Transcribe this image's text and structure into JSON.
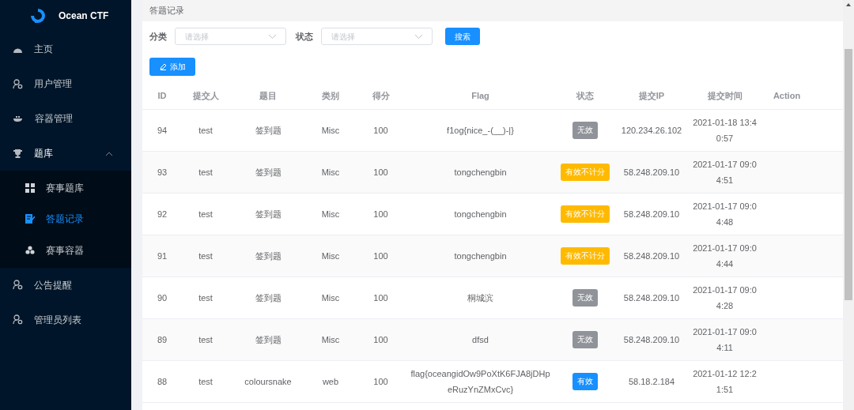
{
  "brand": {
    "name": "Ocean CTF"
  },
  "sidebar": {
    "items": [
      {
        "label": "主页"
      },
      {
        "label": "用户管理"
      },
      {
        "label": "容器管理"
      },
      {
        "label": "题库",
        "expanded": true,
        "children": [
          {
            "label": "赛事题库",
            "selected": false
          },
          {
            "label": "答题记录",
            "selected": true
          },
          {
            "label": "赛事容器",
            "selected": false
          }
        ]
      },
      {
        "label": "公告提醒"
      },
      {
        "label": "管理员列表"
      }
    ]
  },
  "page_title": "答题记录",
  "filters": [
    {
      "label": "分类",
      "placeholder": "请选择"
    },
    {
      "label": "状态",
      "placeholder": "请选择"
    }
  ],
  "search_button": "搜索",
  "add_button": "添加",
  "table": {
    "columns": [
      "ID",
      "提交人",
      "题目",
      "类别",
      "得分",
      "Flag",
      "状态",
      "提交IP",
      "提交时间",
      "Action"
    ],
    "rows": [
      {
        "cells": [
          "94",
          "test",
          "签到题",
          "Misc",
          "100",
          "f1og{nice_-(__)-|}"
        ],
        "status": {
          "kind": "invalid",
          "label": "无效"
        },
        "ip": "120.234.26.102",
        "time": "2021-01-18 13:40:57"
      },
      {
        "cells": [
          "93",
          "test",
          "签到题",
          "Misc",
          "100",
          "tongchengbin"
        ],
        "status": {
          "kind": "no_score",
          "label": "有效不计分"
        },
        "ip": "58.248.209.10",
        "time": "2021-01-17 09:04:51"
      },
      {
        "cells": [
          "92",
          "test",
          "签到题",
          "Misc",
          "100",
          "tongchengbin"
        ],
        "status": {
          "kind": "no_score",
          "label": "有效不计分"
        },
        "ip": "58.248.209.10",
        "time": "2021-01-17 09:04:48"
      },
      {
        "cells": [
          "91",
          "test",
          "签到题",
          "Misc",
          "100",
          "tongchengbin"
        ],
        "status": {
          "kind": "no_score",
          "label": "有效不计分"
        },
        "ip": "58.248.209.10",
        "time": "2021-01-17 09:04:44"
      },
      {
        "cells": [
          "90",
          "test",
          "签到题",
          "Misc",
          "100",
          "桐城滨"
        ],
        "status": {
          "kind": "invalid",
          "label": "无效"
        },
        "ip": "58.248.209.10",
        "time": "2021-01-17 09:04:28"
      },
      {
        "cells": [
          "89",
          "test",
          "签到题",
          "Misc",
          "100",
          "dfsd"
        ],
        "status": {
          "kind": "invalid",
          "label": "无效"
        },
        "ip": "58.248.209.10",
        "time": "2021-01-17 09:04:11"
      },
      {
        "cells": [
          "88",
          "test",
          "coloursnake",
          "web",
          "100",
          "flag{oceangidOw9PoXtK6FJA8jDHpeRuzYnZMxCvc}"
        ],
        "status": {
          "kind": "valid",
          "label": "有效"
        },
        "ip": "58.18.2.184",
        "time": "2021-01-12 12:21:51"
      }
    ]
  }
}
